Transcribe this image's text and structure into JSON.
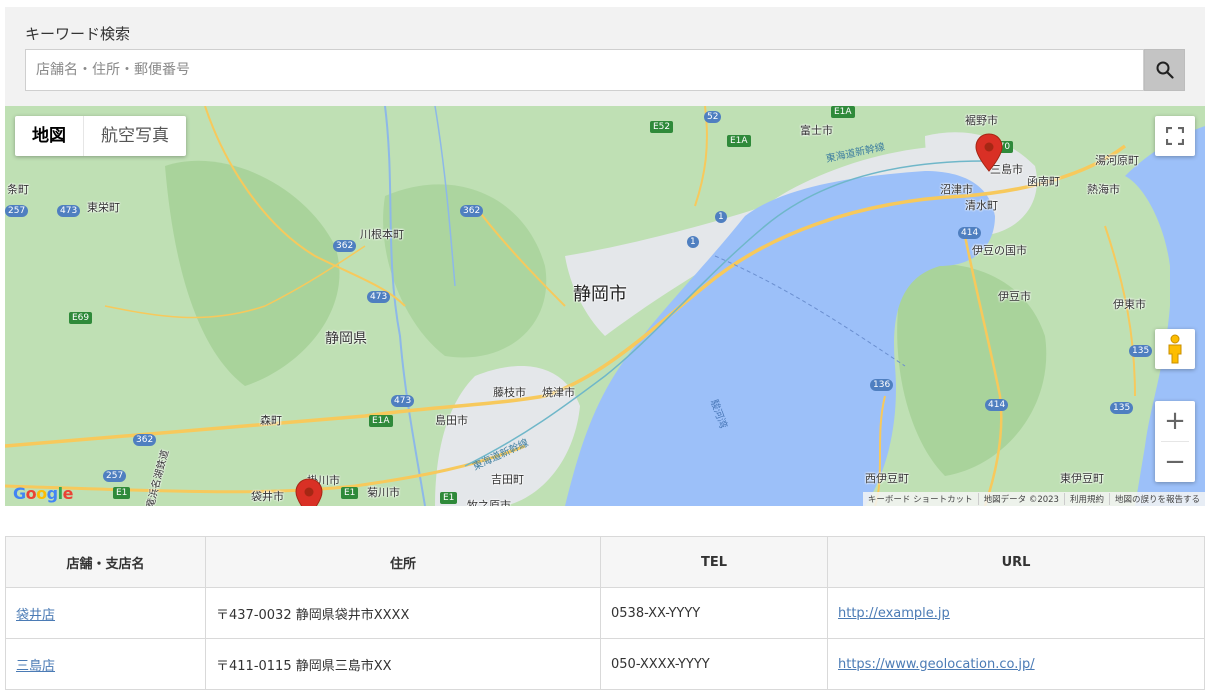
{
  "search": {
    "label": "キーワード検索",
    "placeholder": "店舗名・住所・郵便番号",
    "value": ""
  },
  "map": {
    "type_toggle": {
      "map_label": "地図",
      "satellite_label": "航空写真",
      "selected": "地図"
    },
    "labels": {
      "shizuoka_city": "静岡市",
      "shizuoka_pref": "静岡県",
      "fuji": "富士市",
      "susono": "裾野市",
      "mishima": "三島市",
      "kannami": "函南町",
      "atami": "熱海市",
      "yugawara": "湯河原町",
      "manazuru": "真鶴",
      "numazu": "沼津市",
      "shimizu_town": "清水町",
      "izunokuni": "伊豆の国市",
      "izu": "伊豆市",
      "ito": "伊東市",
      "nishiizu": "西伊豆町",
      "higashiizu": "東伊豆町",
      "kawanehon": "川根本町",
      "toei": "東栄町",
      "mori": "森町",
      "fujieda": "藤枝市",
      "yaizu": "焼津市",
      "shimada": "島田市",
      "yoshida": "吉田町",
      "kakegawa": "掛川市",
      "kikugawa": "菊川市",
      "fukuroi": "袋井市",
      "makinohara": "牧之原市",
      "left_edge": "条町",
      "shinkansen1": "東海道新幹線",
      "shinkansen2": "東海道新幹線",
      "suruga_bay": "駿河湾",
      "tenryu_rail": "天竜浜名湖鉄道"
    },
    "routes": [
      "473",
      "362",
      "362",
      "473",
      "362",
      "257",
      "473",
      "52",
      "1",
      "1",
      "414",
      "136",
      "414",
      "135",
      "135",
      "257"
    ],
    "green_routes": [
      "E1A",
      "E52",
      "E1A",
      "E69",
      "E1A",
      "E1",
      "E1",
      "E1",
      "E70"
    ],
    "attribution": {
      "shortcuts": "キーボード ショートカット",
      "map_data": "地図データ ©2023",
      "terms": "利用規約",
      "report": "地図の誤りを報告する"
    },
    "logo": "Google",
    "zoom_in": "+",
    "zoom_out": "−",
    "colors": {
      "water": "#9cc0f9",
      "land": "#bfe0b4",
      "road": "#f7c95c",
      "pin": "#d93025"
    }
  },
  "table": {
    "headers": [
      "店舗・支店名",
      "住所",
      "TEL",
      "URL"
    ],
    "rows": [
      {
        "name": "袋井店",
        "address": "〒437-0032 静岡県袋井市XXXX",
        "tel": "0538-XX-YYYY",
        "url": "http://example.jp"
      },
      {
        "name": "三島店",
        "address": "〒411-0115 静岡県三島市XX",
        "tel": "050-XXXX-YYYY",
        "url": "https://www.geolocation.co.jp/"
      }
    ]
  }
}
